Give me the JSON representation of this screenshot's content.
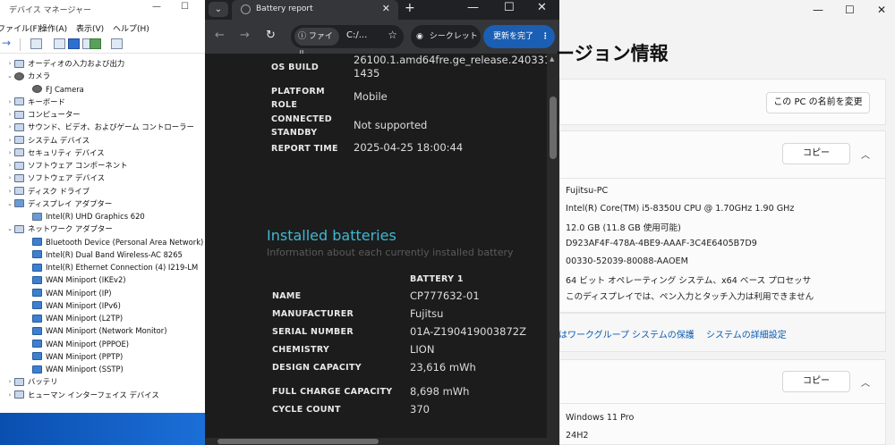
{
  "device_manager": {
    "title": "デバイス マネージャー",
    "menu": [
      "ファイル(F)",
      "操作(A)",
      "表示(V)",
      "ヘルプ(H)"
    ],
    "tree": [
      {
        "label": "オーディオの入力および出力",
        "level": 0,
        "exp": "›"
      },
      {
        "label": "カメラ",
        "level": 0,
        "exp": "⌄"
      },
      {
        "label": "FJ Camera",
        "level": 1,
        "exp": ""
      },
      {
        "label": "キーボード",
        "level": 0,
        "exp": "›"
      },
      {
        "label": "コンピューター",
        "level": 0,
        "exp": "›"
      },
      {
        "label": "サウンド、ビデオ、およびゲーム コントローラー",
        "level": 0,
        "exp": "›"
      },
      {
        "label": "システム デバイス",
        "level": 0,
        "exp": "›"
      },
      {
        "label": "セキュリティ デバイス",
        "level": 0,
        "exp": "›"
      },
      {
        "label": "ソフトウェア コンポーネント",
        "level": 0,
        "exp": "›"
      },
      {
        "label": "ソフトウェア デバイス",
        "level": 0,
        "exp": "›"
      },
      {
        "label": "ディスク ドライブ",
        "level": 0,
        "exp": "›"
      },
      {
        "label": "ディスプレイ アダプター",
        "level": 0,
        "exp": "⌄"
      },
      {
        "label": "Intel(R) UHD Graphics 620",
        "level": 1,
        "exp": ""
      },
      {
        "label": "ネットワーク アダプター",
        "level": 0,
        "exp": "⌄"
      },
      {
        "label": "Bluetooth Device (Personal Area Network)",
        "level": 1,
        "exp": ""
      },
      {
        "label": "Intel(R) Dual Band Wireless-AC 8265",
        "level": 1,
        "exp": ""
      },
      {
        "label": "Intel(R) Ethernet Connection (4) I219-LM",
        "level": 1,
        "exp": ""
      },
      {
        "label": "WAN Miniport (IKEv2)",
        "level": 1,
        "exp": ""
      },
      {
        "label": "WAN Miniport (IP)",
        "level": 1,
        "exp": ""
      },
      {
        "label": "WAN Miniport (IPv6)",
        "level": 1,
        "exp": ""
      },
      {
        "label": "WAN Miniport (L2TP)",
        "level": 1,
        "exp": ""
      },
      {
        "label": "WAN Miniport (Network Monitor)",
        "level": 1,
        "exp": ""
      },
      {
        "label": "WAN Miniport (PPPOE)",
        "level": 1,
        "exp": ""
      },
      {
        "label": "WAN Miniport (PPTP)",
        "level": 1,
        "exp": ""
      },
      {
        "label": "WAN Miniport (SSTP)",
        "level": 1,
        "exp": ""
      },
      {
        "label": "バッテリ",
        "level": 0,
        "exp": "›"
      },
      {
        "label": "ヒューマン インターフェイス デバイス",
        "level": 0,
        "exp": "›"
      }
    ]
  },
  "chrome": {
    "tab_title": "Battery report",
    "omnibox_chip": "ファイル",
    "omnibox_url": "C:/...",
    "incognito": "シークレット",
    "update_button": "更新を完了"
  },
  "report": {
    "system_rows": [
      {
        "label": "OS BUILD",
        "value": "26100.1.amd64fre.ge_release.240331-1435"
      },
      {
        "label": "PLATFORM ROLE",
        "value": "Mobile"
      },
      {
        "label": "CONNECTED STANDBY",
        "value": "Not supported"
      },
      {
        "label": "REPORT TIME",
        "value": "2025-04-25  18:00:44"
      }
    ],
    "installed_heading": "Installed batteries",
    "installed_sub": "Information about each currently installed battery",
    "battery_header": "BATTERY 1",
    "battery_rows": [
      {
        "label": "NAME",
        "value": "CP777632-01"
      },
      {
        "label": "MANUFACTURER",
        "value": "Fujitsu"
      },
      {
        "label": "SERIAL NUMBER",
        "value": "01A-Z190419003872Z"
      },
      {
        "label": "CHEMISTRY",
        "value": "LION"
      },
      {
        "label": "DESIGN CAPACITY",
        "value": "23,616 mWh"
      },
      {
        "label": "FULL CHARGE CAPACITY",
        "value": "8,698 mWh"
      },
      {
        "label": "CYCLE COUNT",
        "value": "370"
      }
    ]
  },
  "settings": {
    "title": "ージョン情報",
    "rename_button": "この PC の名前を変更",
    "copy_button": "コピー",
    "specs": [
      "Fujitsu-PC",
      "Intel(R) Core(TM) i5-8350U CPU @ 1.70GHz   1.90 GHz",
      "12.0 GB (11.8 GB 使用可能)",
      "D923AF4F-478A-4BE9-AAAF-3C4E6405B7D9",
      "00330-52039-80088-AAOEM",
      "64 ビット オペレーティング システム、x64 ベース プロセッサ",
      "このディスプレイでは、ペン入力とタッチ入力は利用できません"
    ],
    "links": [
      "はワークグループ",
      "システムの保護",
      "システムの詳細設定"
    ],
    "copy_button_2": "コピー",
    "win_specs": [
      "Windows 11 Pro",
      "24H2"
    ]
  }
}
